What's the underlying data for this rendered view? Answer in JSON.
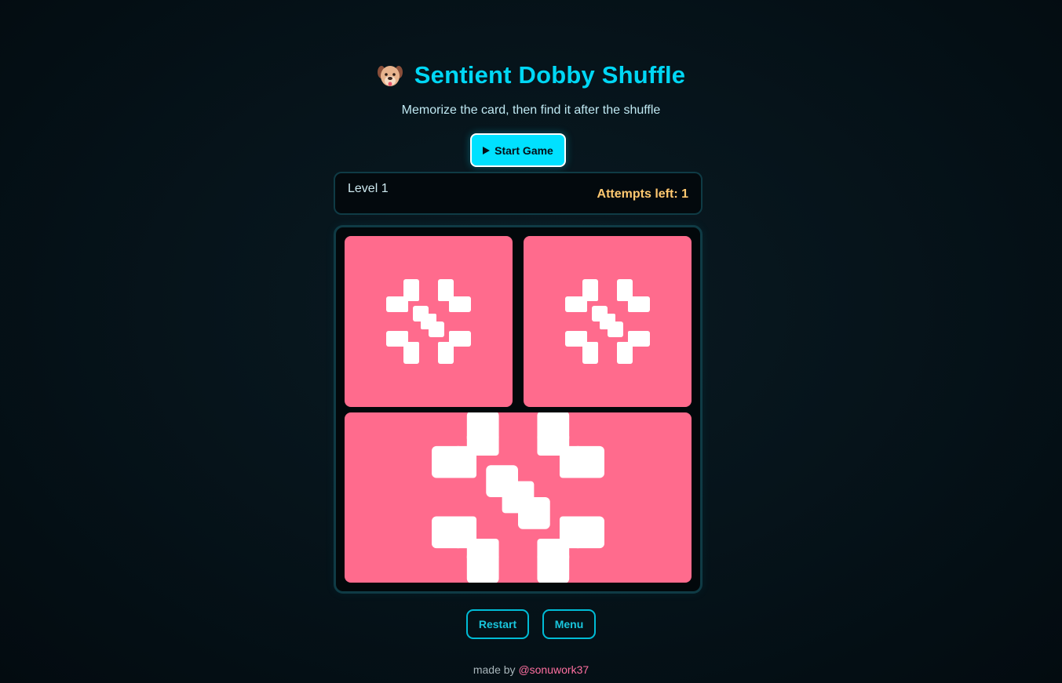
{
  "header": {
    "title": "Sentient Dobby Shuffle",
    "subtitle": "Memorize the card, then find it after the shuffle",
    "logo_icon": "dog-face-icon"
  },
  "controls": {
    "start_label": "Start Game",
    "start_icon": "play-icon"
  },
  "status": {
    "level_text": "Level 1",
    "attempts_text": "Attempts left: 1"
  },
  "board": {
    "card_color": "#ff6b8d",
    "card_count": 3,
    "card_icon": "sentient-logo-icon"
  },
  "actions": {
    "restart_label": "Restart",
    "menu_label": "Menu"
  },
  "footer": {
    "prefix": "made by",
    "author": "@sonuwork37"
  },
  "colors": {
    "accent": "#00d7f5",
    "attempts": "#ffc870",
    "link": "#ff6fa0"
  }
}
